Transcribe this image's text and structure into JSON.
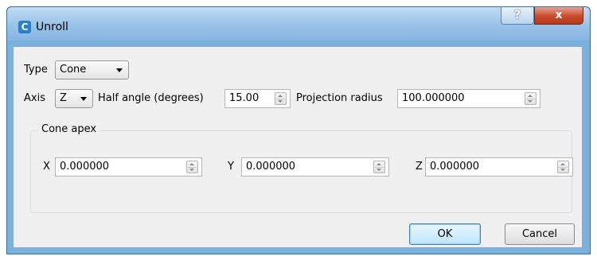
{
  "window": {
    "title": "Unroll",
    "app_icon": "unroll-app-icon",
    "help_label": "?",
    "close_label": "x"
  },
  "form": {
    "type_label": "Type",
    "type_value": "Cone",
    "axis_label": "Axis",
    "axis_value": "Z",
    "half_angle_label": "Half angle (degrees)",
    "half_angle_value": "15.00",
    "projection_radius_label": "Projection radius",
    "projection_radius_value": "100.000000"
  },
  "cone_apex": {
    "title": "Cone apex",
    "x_label": "X",
    "x_value": "0.000000",
    "y_label": "Y",
    "y_value": "0.000000",
    "z_label": "Z",
    "z_value": "0.000000"
  },
  "buttons": {
    "ok": "OK",
    "cancel": "Cancel"
  },
  "colors": {
    "titlebar": "#98c2e8",
    "close_button": "#c74b2b",
    "dialog_bg": "#f0f0f0"
  }
}
